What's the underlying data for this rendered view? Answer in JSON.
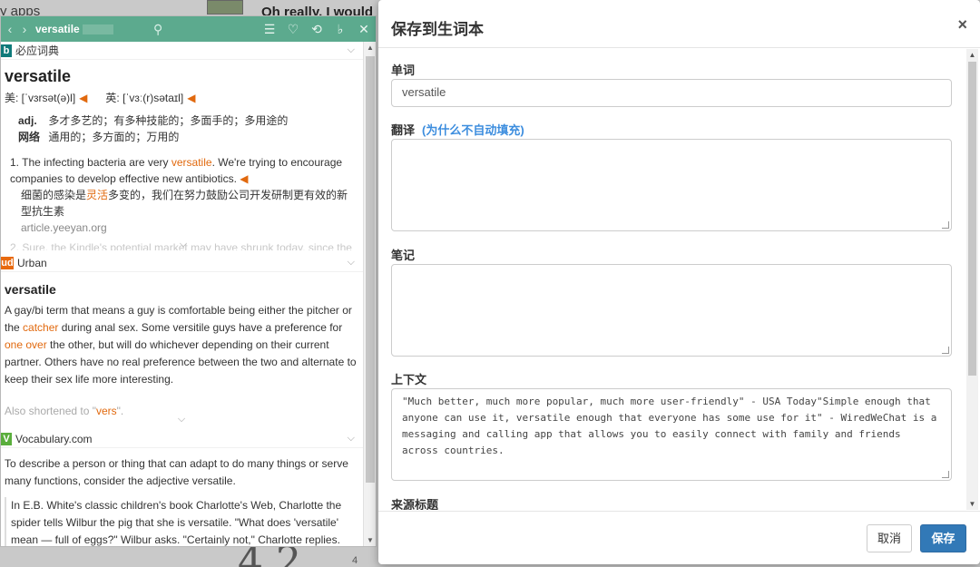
{
  "background": {
    "apps_text": "y apps",
    "chat_text": "Oh really, I would",
    "big_number": "4 2",
    "small_number": "4"
  },
  "dict": {
    "search_value": "versatile",
    "bing": {
      "source": "必应词典",
      "word": "versatile",
      "us_phon": "美: [ˈvɜrsət(ə)l]",
      "uk_phon": "英: [ˈvɜː(r)sətaɪl]",
      "defs": [
        {
          "pos": "adj.",
          "text": "多才多艺的；有多种技能的；多面手的；多用途的"
        },
        {
          "pos": "网络",
          "text": "通用的；多方面的；万用的"
        }
      ],
      "sentence_prefix": "1. The infecting bacteria are very ",
      "sentence_hl": "versatile",
      "sentence_suffix": ". We're trying to encourage companies to develop effective new antibiotics.",
      "translation_prefix": "细菌的感染是",
      "translation_hl": "灵活",
      "translation_suffix": "多变的，我们在努力鼓励公司开发研制更有效的新型抗生素",
      "sentence_src": "article.yeeyan.org",
      "faded_sentence": "2. Sure, the Kindle's potential market may have shrunk today, since the"
    },
    "urban": {
      "source": "Urban",
      "logo": "ud",
      "word": "versatile",
      "def_1": "A gay/bi term that means a guy is comfortable being either the pitcher or the ",
      "def_hl1": "catcher",
      "def_2": " during anal sex. Some versitile guys have a preference for ",
      "def_hl2": "one over",
      "def_3": " the other, but will do whichever depending on their current partner. Others have no real preference between the two and alternate to keep their sex life more interesting.",
      "short_prefix": "Also shortened to \"",
      "short_hl": "vers",
      "short_suffix": "\"."
    },
    "vocab": {
      "source": "Vocabulary.com",
      "logo": "V",
      "desc": "To describe a person or thing that can adapt to do many things or serve many functions, consider the adjective versatile.",
      "quote": "In E.B. White's classic children's book Charlotte's Web, Charlotte the spider tells Wilbur the pig that she is versatile. \"What does 'versatile' mean — full of eggs?\" Wilbur asks. \"Certainly not,\" Charlotte replies."
    }
  },
  "modal": {
    "title": "保存到生词本",
    "close": "×",
    "word_label": "单词",
    "word_value": "versatile",
    "translation_label": "翻译",
    "translation_hint": "(为什么不自动填充)",
    "notes_label": "笔记",
    "context_label": "上下文",
    "context_value": "\"Much better, much more popular, much more user-friendly\" - USA Today\"Simple enough that anyone can use it, versatile enough that everyone has some use for it\" - WiredWeChat is a messaging and calling app that allows you to easily connect with family and friends across countries.",
    "source_title_label": "来源标题",
    "cancel": "取消",
    "save": "保存"
  },
  "colors": {
    "topbar": "#5caa8e",
    "highlight": "#e1690e",
    "primary": "#3279b7",
    "hint": "#3c8dde"
  }
}
